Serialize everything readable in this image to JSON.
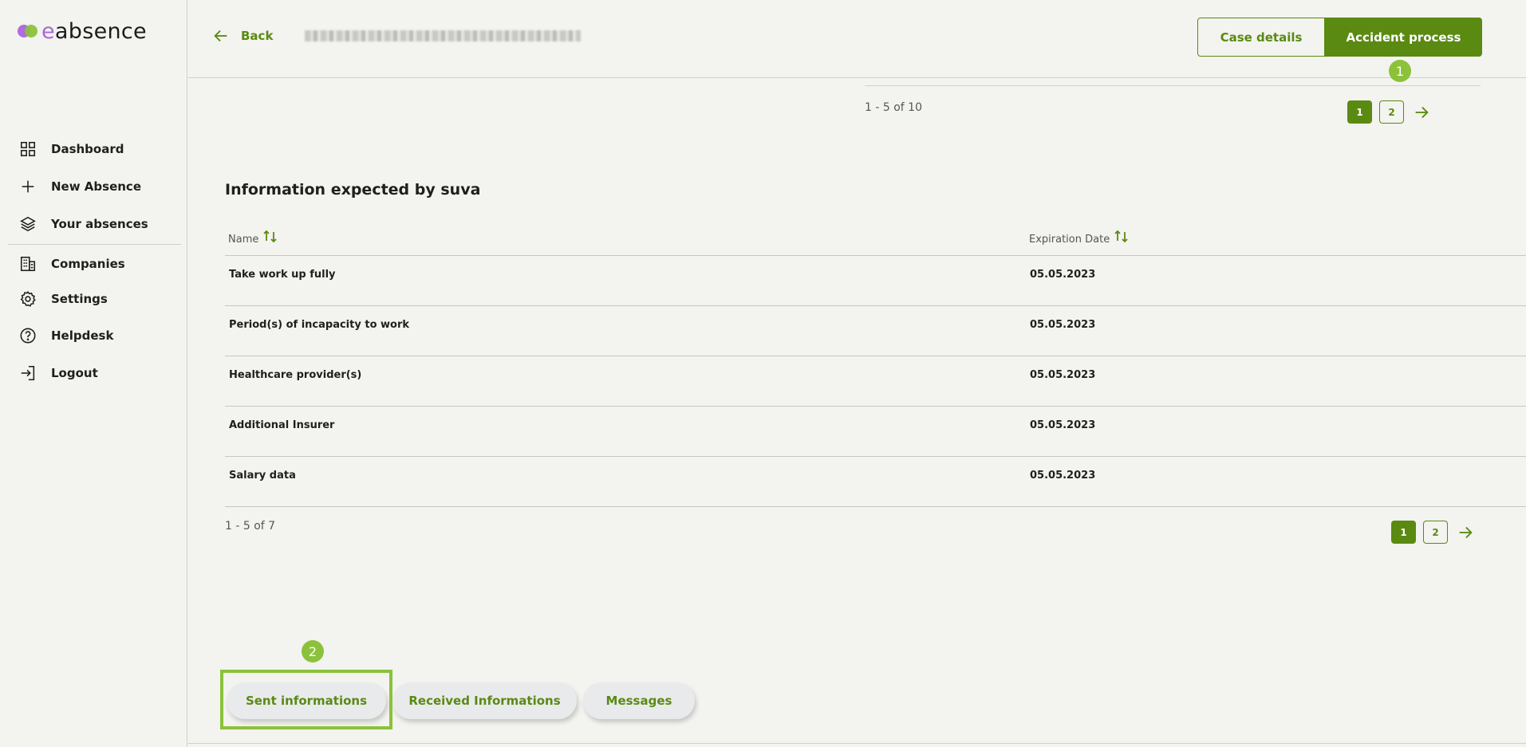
{
  "brand": {
    "prefix": "e",
    "rest": "absence"
  },
  "sidebar": {
    "items": [
      {
        "label": "Dashboard",
        "icon": "grid-icon"
      },
      {
        "label": "New Absence",
        "icon": "plus-icon"
      },
      {
        "label": "Your absences",
        "icon": "layers-icon"
      },
      {
        "label": "Companies",
        "icon": "building-icon"
      },
      {
        "label": "Settings",
        "icon": "gear-icon"
      },
      {
        "label": "Helpdesk",
        "icon": "help-circle-icon"
      },
      {
        "label": "Logout",
        "icon": "logout-icon"
      }
    ]
  },
  "header": {
    "back_label": "Back",
    "case_details_label": "Case details",
    "accident_process_label": "Accident process"
  },
  "markers": {
    "first": "1",
    "second": "2"
  },
  "top_pager": {
    "count": "1 - 5 of 10",
    "pages": [
      "1",
      "2"
    ]
  },
  "expected": {
    "title": "Information expected by suva",
    "columns": {
      "name": "Name",
      "expiration": "Expiration Date"
    },
    "rows": [
      {
        "name": "Take work up fully",
        "date": "05.05.2023"
      },
      {
        "name": "Period(s) of incapacity to work",
        "date": "05.05.2023"
      },
      {
        "name": "Healthcare provider(s)",
        "date": "05.05.2023"
      },
      {
        "name": "Additional Insurer",
        "date": "05.05.2023"
      },
      {
        "name": "Salary data",
        "date": "05.05.2023"
      }
    ],
    "pager": {
      "count": "1 - 5 of 7",
      "pages": [
        "1",
        "2"
      ]
    }
  },
  "tabs": [
    "Sent informations",
    "Received Informations",
    "Messages"
  ],
  "colors": {
    "accent": "#5a8a12",
    "marker": "#8bc23a",
    "background": "#f3f3ef"
  }
}
